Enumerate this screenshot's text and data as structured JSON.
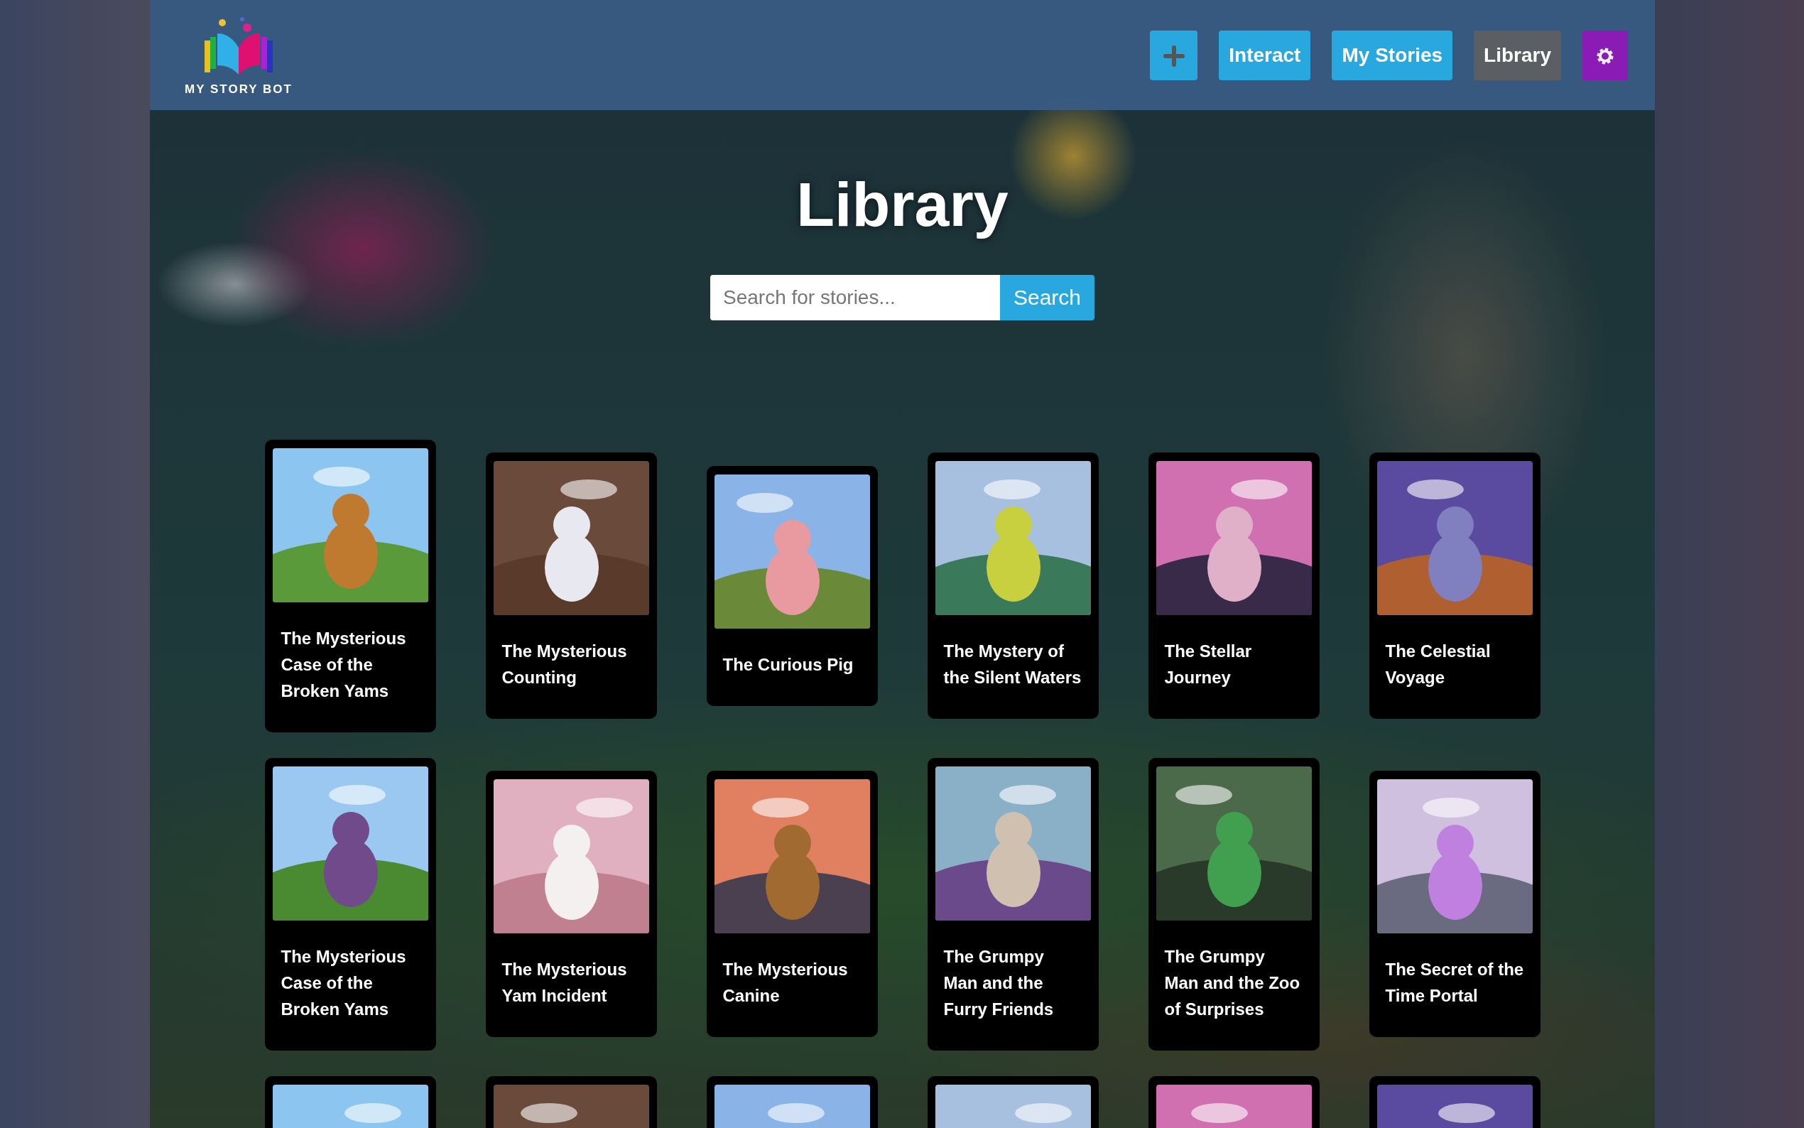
{
  "logo": {
    "text": "MY STORY BOT"
  },
  "nav": [
    {
      "kind": "add",
      "selected": false
    },
    {
      "kind": "link",
      "label": "Interact",
      "selected": false
    },
    {
      "kind": "link",
      "label": "My Stories",
      "selected": false
    },
    {
      "kind": "link",
      "label": "Library",
      "selected": true
    },
    {
      "kind": "settings",
      "selected": false
    }
  ],
  "heading": "Library",
  "search": {
    "placeholder": "Search for stories...",
    "button": "Search"
  },
  "card_rows": [
    [
      {
        "title": "The Mysterious Case of the Broken Yams"
      },
      {
        "title": "The Mysterious Counting"
      },
      {
        "title": "The Curious Pig"
      },
      {
        "title": "The Mystery of the Silent Waters"
      },
      {
        "title": "The Stellar Journey"
      },
      {
        "title": "The Celestial Voyage"
      }
    ],
    [
      {
        "title": "The Mysterious Case of the Broken Yams"
      },
      {
        "title": "The Mysterious Yam Incident"
      },
      {
        "title": "The Mysterious Canine"
      },
      {
        "title": "The Grumpy Man and the Furry Friends"
      },
      {
        "title": "The Grumpy Man and the Zoo of Surprises"
      },
      {
        "title": "The Secret of the Time Portal"
      }
    ],
    [
      {},
      {},
      {},
      {},
      {},
      {}
    ]
  ]
}
